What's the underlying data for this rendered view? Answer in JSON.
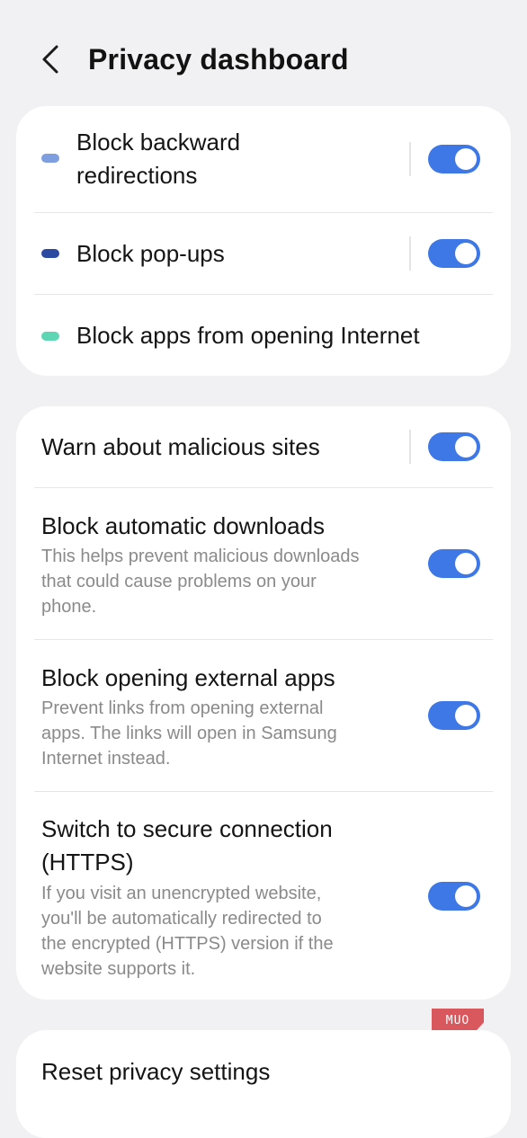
{
  "header": {
    "title": "Privacy dashboard",
    "back_icon": "chevron-left-icon"
  },
  "colors": {
    "toggle_on": "#3e78e6",
    "dot_backward": "#7f9ee0",
    "dot_popups": "#2b4aa0",
    "dot_apps": "#5ed6b4",
    "watermark": "#d8585e"
  },
  "blocking": {
    "backward": {
      "label_line1": "Block backward",
      "label_line2": "redirections",
      "enabled": true
    },
    "popups": {
      "label": "Block pop-ups",
      "enabled": true
    },
    "apps_opening": {
      "label": "Block apps from opening Internet"
    }
  },
  "security": {
    "malicious": {
      "label": "Warn about malicious sites",
      "enabled": true
    },
    "downloads": {
      "label": "Block automatic downloads",
      "desc_lines": [
        "This helps prevent malicious downloads",
        "that could cause problems on your",
        "phone."
      ],
      "enabled": true
    },
    "external_apps": {
      "label": "Block opening external apps",
      "desc_lines": [
        "Prevent links from opening external",
        "apps. The links will open in Samsung",
        "Internet instead."
      ],
      "enabled": true
    },
    "https": {
      "label_lines": [
        "Switch to secure connection",
        "(HTTPS)"
      ],
      "desc_lines": [
        "If you visit an unencrypted website,",
        "you'll be automatically redirected to",
        "the encrypted (HTTPS) version if the",
        "website supports it."
      ],
      "enabled": true
    }
  },
  "reset": {
    "label": "Reset privacy settings"
  },
  "watermark": {
    "text": "MUO"
  }
}
